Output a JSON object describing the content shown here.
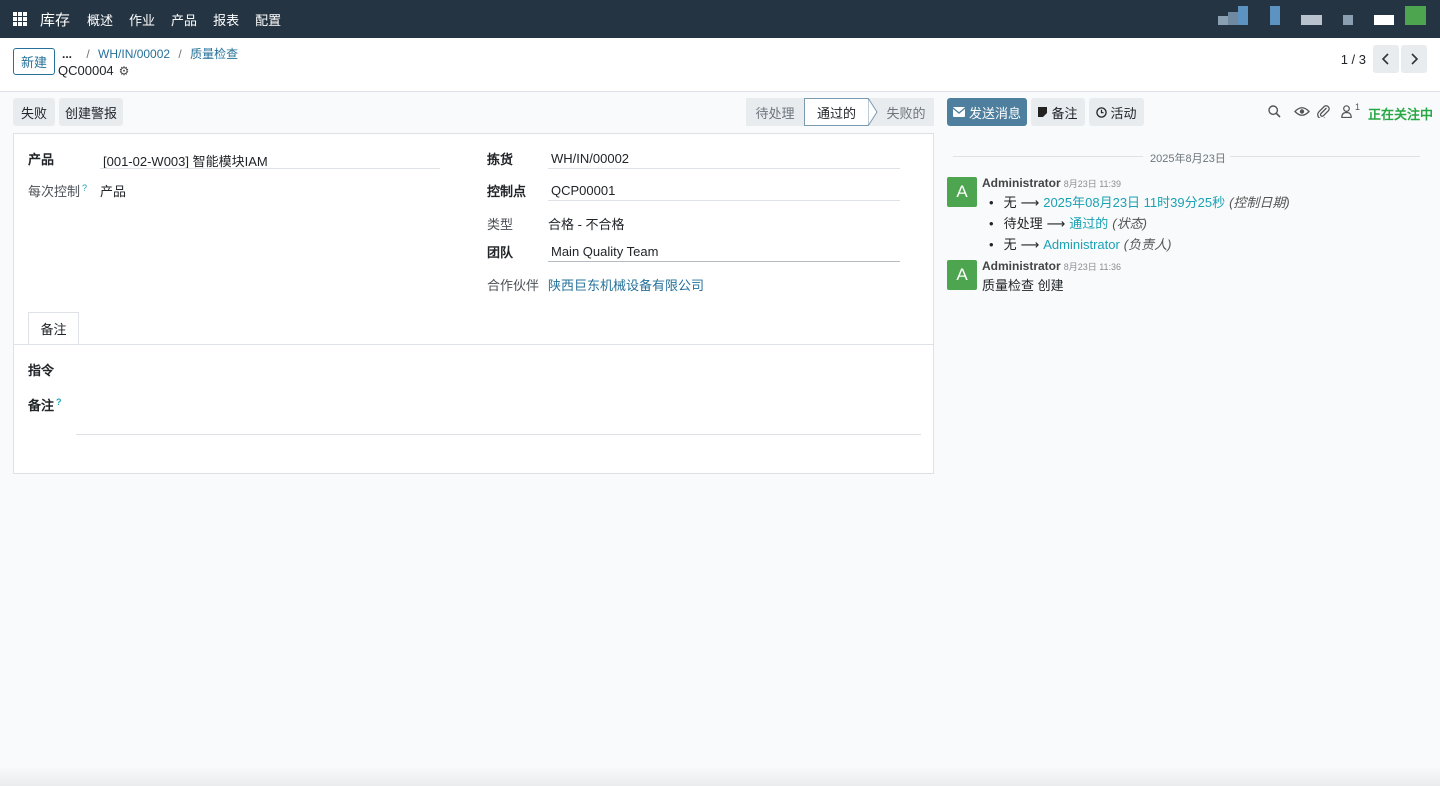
{
  "navbar": {
    "app_name": "库存",
    "menu": [
      "概述",
      "作业",
      "产品",
      "报表",
      "配置"
    ]
  },
  "control": {
    "new_button": "新建",
    "breadcrumb_dots": "...",
    "breadcrumb": [
      "WH/IN/00002",
      "质量检查"
    ],
    "breadcrumb_sep": "/",
    "record_name": "QC00004",
    "pager": "1 / 3"
  },
  "actions": {
    "fail": "失败",
    "create_alert": "创建警报",
    "stages": [
      "待处理",
      "通过的",
      "失败的"
    ],
    "active_stage": "通过的"
  },
  "form": {
    "product_label": "产品",
    "product_value": "[001-02-W003] 智能模块IAM",
    "control_per_label": "每次控制",
    "control_per_value": "产品",
    "picking_label": "拣货",
    "picking_value": "WH/IN/00002",
    "control_point_label": "控制点",
    "control_point_value": "QCP00001",
    "type_label": "类型",
    "type_value": "合格 - 不合格",
    "team_label": "团队",
    "team_value": "Main Quality Team",
    "partner_label": "合作伙伴",
    "partner_value": "陕西巨东机械设备有限公司",
    "help_mark": "?",
    "tab_notes": "备注",
    "instructions_label": "指令",
    "notes_label": "备注"
  },
  "chatter": {
    "send_message": "发送消息",
    "log_note": "备注",
    "activity": "活动",
    "follower_count": "1",
    "following": "正在关注中",
    "date_separator": "2025年8月23日",
    "messages": [
      {
        "avatar": "A",
        "author": "Administrator",
        "time": "8月23日 11:39",
        "tracking": [
          {
            "old": "无",
            "new": "2025年08月23日 11时39分25秒",
            "field": "(控制日期)"
          },
          {
            "old": "待处理",
            "new": "通过的",
            "field": "(状态)"
          },
          {
            "old": "无",
            "new": "Administrator",
            "field": "(负责人)"
          }
        ]
      },
      {
        "avatar": "A",
        "author": "Administrator",
        "time": "8月23日 11:36",
        "body": "质量检查 创建"
      }
    ]
  }
}
